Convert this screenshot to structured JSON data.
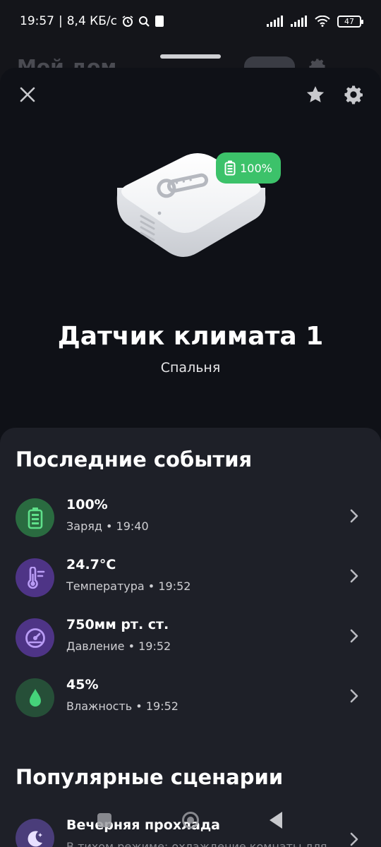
{
  "status_bar": {
    "time": "19:57",
    "speed": "8,4 КБ/с",
    "battery": "47"
  },
  "background": {
    "title": "Мой дом"
  },
  "device": {
    "name": "Датчик климата 1",
    "room": "Спальня",
    "battery_badge": "100%"
  },
  "events": {
    "title": "Последние события",
    "items": [
      {
        "value": "100%",
        "subtitle": "Заряд • 19:40",
        "icon": "battery-icon",
        "color": "#2a6b40"
      },
      {
        "value": "24.7°C",
        "subtitle": "Температура • 19:52",
        "icon": "thermometer-icon",
        "color": "#5a3a8a"
      },
      {
        "value": "750мм рт. ст.",
        "subtitle": "Давление • 19:52",
        "icon": "gauge-icon",
        "color": "#5a3a8a"
      },
      {
        "value": "45%",
        "subtitle": "Влажность • 19:52",
        "icon": "droplet-icon",
        "color": "#2a5d3f"
      }
    ]
  },
  "scenarios": {
    "title": "Популярные сценарии",
    "items": [
      {
        "title": "Вечерняя прохлада",
        "subtitle": "В тихом режиме: охлаждение комнаты для",
        "icon": "moon-icon"
      }
    ]
  },
  "colors": {
    "accent_green": "#3cc26a",
    "sheet_bg": "#0f1117",
    "content_bg": "#1e2028"
  }
}
